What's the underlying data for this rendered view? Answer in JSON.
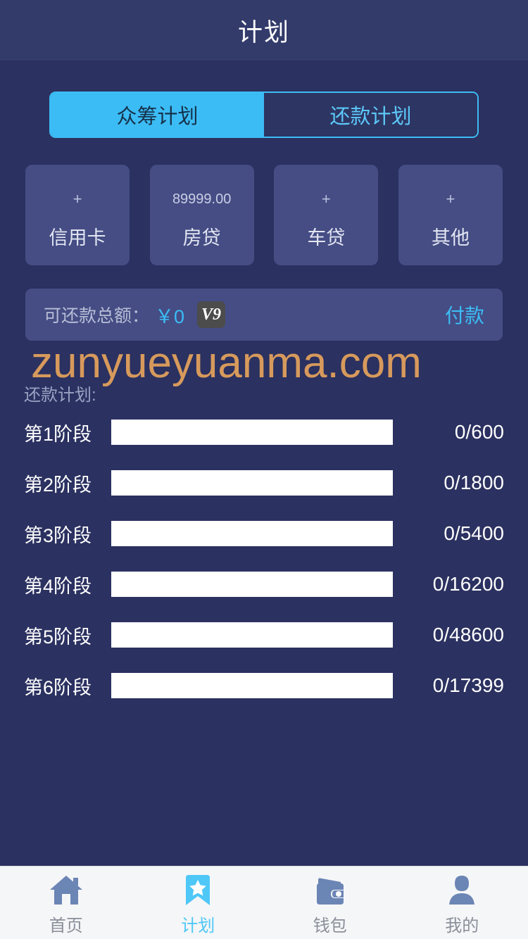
{
  "header": {
    "title": "计划"
  },
  "tabs": [
    {
      "label": "众筹计划",
      "active": true
    },
    {
      "label": "还款计划",
      "active": false
    }
  ],
  "cards": [
    {
      "value": "+",
      "label": "信用卡",
      "is_plus": true
    },
    {
      "value": "89999.00",
      "label": "房贷",
      "is_plus": false
    },
    {
      "value": "+",
      "label": "车贷",
      "is_plus": true
    },
    {
      "value": "+",
      "label": "其他",
      "is_plus": true
    }
  ],
  "summary": {
    "label": "可还款总额：",
    "amount": "￥0",
    "badge": "V9",
    "pay_label": "付款"
  },
  "watermark": "zunyueyuanma.com",
  "plan": {
    "heading": "还款计划:",
    "stages": [
      {
        "name": "第1阶段",
        "count": "0/600",
        "current": 0,
        "total": 600,
        "percent": 0
      },
      {
        "name": "第2阶段",
        "count": "0/1800",
        "current": 0,
        "total": 1800,
        "percent": 0
      },
      {
        "name": "第3阶段",
        "count": "0/5400",
        "current": 0,
        "total": 5400,
        "percent": 0
      },
      {
        "name": "第4阶段",
        "count": "0/16200",
        "current": 0,
        "total": 16200,
        "percent": 0
      },
      {
        "name": "第5阶段",
        "count": "0/48600",
        "current": 0,
        "total": 48600,
        "percent": 0
      },
      {
        "name": "第6阶段",
        "count": "0/17399",
        "current": 0,
        "total": 17399,
        "percent": 0
      }
    ]
  },
  "bottom_nav": [
    {
      "icon": "home-icon",
      "label": "首页",
      "active": false
    },
    {
      "icon": "bookmark-star-icon",
      "label": "计划",
      "active": true
    },
    {
      "icon": "wallet-icon",
      "label": "钱包",
      "active": false
    },
    {
      "icon": "person-icon",
      "label": "我的",
      "active": false
    }
  ],
  "colors": {
    "accent": "#3cbcf5",
    "header_bg": "#333b6b",
    "body_bg": "#2b3160",
    "card_bg": "#454d84",
    "watermark": "#d79a5c",
    "nav_bg": "#f5f6f8",
    "nav_icon": "#6b85b5"
  }
}
